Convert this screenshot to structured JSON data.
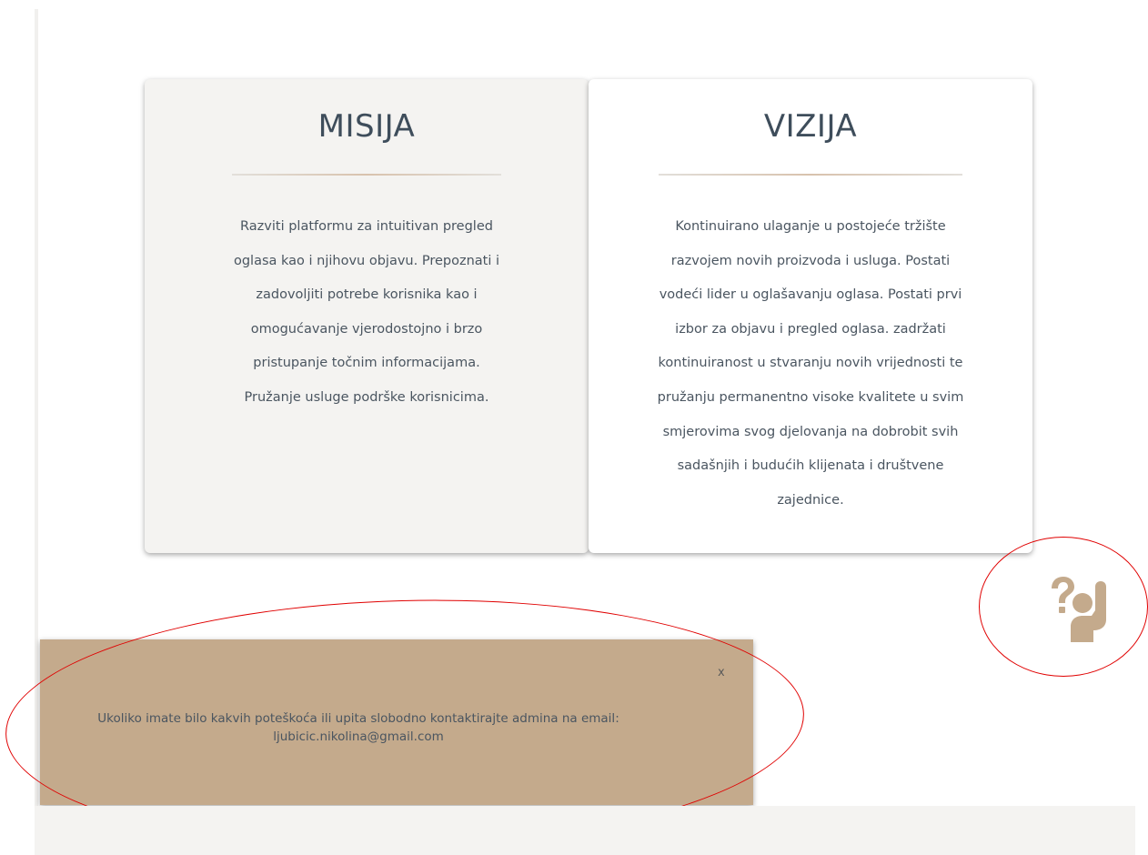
{
  "misija": {
    "title": "MISIJA",
    "text": "Razviti platformu za intuitivan pregled oglasa kao i njihovu objavu. Prepoznati i zadovoljiti potrebe korisnika kao i omogućavanje vjerodostojno i brzo pristupanje točnim informacijama. Pružanje usluge podrške korisnicima."
  },
  "vizija": {
    "title": "VIZIJA",
    "text": "Kontinuirano ulaganje u postojeće tržište razvojem novih proizvoda i usluga. Postati vodeći lider u oglašavanju oglasa. Postati prvi izbor za objavu i pregled oglasa. zadržati kontinuiranost u stvaranju novih vrijednosti te pružanju permanentno visoke kvalitete u svim smjerovima svog djelovanja na dobrobit svih sadašnjih i budućih klijenata i društvene zajednice."
  },
  "help": {
    "icon": "raised-hand-question-icon"
  },
  "notice": {
    "close_label": "x",
    "message": "Ukoliko imate bilo kakvih poteškoća ili upita slobodno kontaktirajte admina na email: ljubicic.nikolina@gmail.com"
  },
  "colors": {
    "card_title": "#3e4d5b",
    "card_text": "#4a5560",
    "misija_bg": "#f4f3f1",
    "vizija_bg": "#ffffff",
    "notice_bg": "#c4aa8c",
    "help_icon": "#c4aa8c",
    "annotation_red": "#e00000"
  }
}
